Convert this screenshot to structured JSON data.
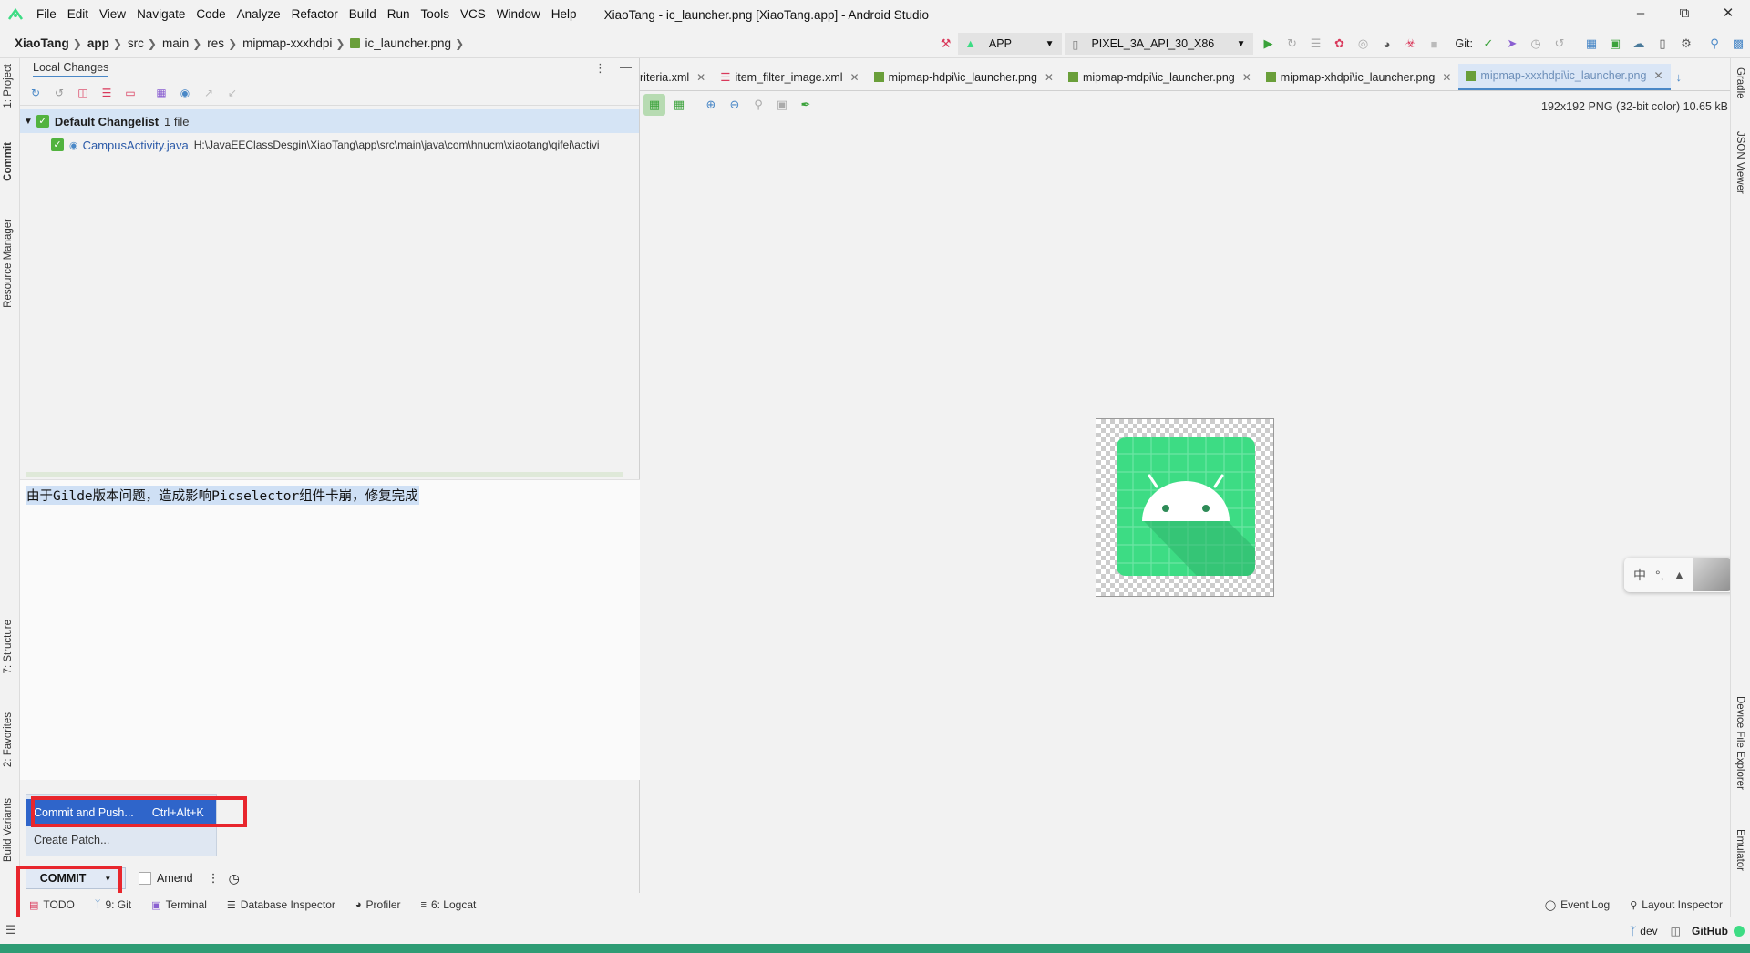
{
  "menu": {
    "items": [
      "File",
      "Edit",
      "View",
      "Navigate",
      "Code",
      "Analyze",
      "Refactor",
      "Build",
      "Run",
      "Tools",
      "VCS",
      "Window",
      "Help"
    ],
    "window_title": "XiaoTang - ic_launcher.png [XiaoTang.app] - Android Studio"
  },
  "breadcrumb": [
    "XiaoTang",
    "app",
    "src",
    "main",
    "res",
    "mipmap-xxxhdpi",
    "ic_launcher.png"
  ],
  "run_config": {
    "module": "APP",
    "device": "PIXEL_3A_API_30_X86",
    "git_label": "Git:"
  },
  "left_stripe": {
    "project": "1: Project",
    "commit": "Commit",
    "resource_manager": "Resource Manager",
    "structure": "7: Structure",
    "favorites": "2: Favorites",
    "build_variants": "Build Variants"
  },
  "right_stripe": {
    "gradle": "Gradle",
    "json_viewer": "JSON Viewer",
    "device_file_explorer": "Device File Explorer",
    "emulator": "Emulator"
  },
  "commit_panel": {
    "tab": "Local Changes",
    "changelist_name": "Default Changelist",
    "changelist_count": "1 file",
    "file_name": "CampusActivity.java",
    "file_path": "H:\\JavaEEClassDesgin\\XiaoTang\\app\\src\\main\\java\\com\\hnucm\\xiaotang\\qifei\\activi",
    "commit_message": "由于Gilde版本问题，造成影响Picselector组件卡崩，修复完成",
    "dropdown": {
      "commit_and_push": "Commit and Push...",
      "shortcut": "Ctrl+Alt+K",
      "create_patch": "Create Patch..."
    },
    "commit_button": "COMMIT",
    "amend_label": "Amend"
  },
  "bottom_tools": [
    {
      "label": "TODO",
      "icon": "todo-icon"
    },
    {
      "label": "9: Git",
      "icon": "git-icon"
    },
    {
      "label": "Terminal",
      "icon": "terminal-icon"
    },
    {
      "label": "Database Inspector",
      "icon": "database-icon"
    },
    {
      "label": "Profiler",
      "icon": "profiler-icon"
    },
    {
      "label": "6: Logcat",
      "icon": "logcat-icon"
    }
  ],
  "bottom_right_tools": {
    "event_log": "Event Log",
    "layout_inspector": "Layout Inspector"
  },
  "status_bar": {
    "branch": "dev",
    "github": "GitHub"
  },
  "editor_tabs": [
    {
      "label": "riteria.xml",
      "active": false
    },
    {
      "label": "item_filter_image.xml",
      "active": false
    },
    {
      "label": "mipmap-hdpi\\ic_launcher.png",
      "active": false
    },
    {
      "label": "mipmap-mdpi\\ic_launcher.png",
      "active": false
    },
    {
      "label": "mipmap-xhdpi\\ic_launcher.png",
      "active": false
    },
    {
      "label": "mipmap-xxxhdpi\\ic_launcher.png",
      "active": true
    }
  ],
  "image_info": "192x192 PNG (32-bit color) 10.65 kB",
  "ime": {
    "mode": "中",
    "punct": "°,"
  },
  "colors": {
    "accent": "#4a88c7",
    "android_green": "#3ddc84",
    "highlight_red": "#e8262d",
    "selection": "#2f65ca"
  }
}
